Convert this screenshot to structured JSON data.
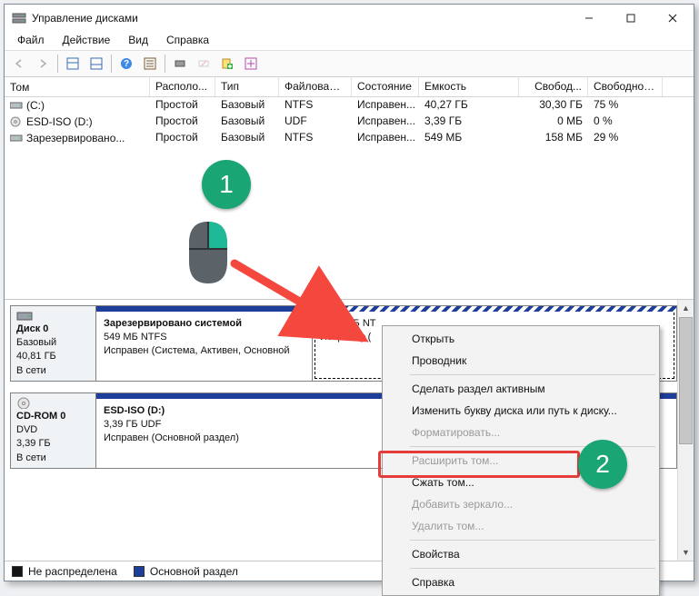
{
  "window": {
    "title": "Управление дисками"
  },
  "menu": {
    "file": "Файл",
    "action": "Действие",
    "view": "Вид",
    "help": "Справка"
  },
  "columns": {
    "volume": "Том",
    "layout": "Располо...",
    "type": "Тип",
    "fs": "Файловая с...",
    "status": "Состояние",
    "capacity": "Емкость",
    "free": "Свобод...",
    "free_pct": "Свободно %"
  },
  "rows": [
    {
      "name": "(C:)",
      "layout": "Простой",
      "type": "Базовый",
      "fs": "NTFS",
      "status": "Исправен...",
      "capacity": "40,27 ГБ",
      "free": "30,30 ГБ",
      "free_pct": "75 %",
      "icon": "drive"
    },
    {
      "name": "ESD-ISO (D:)",
      "layout": "Простой",
      "type": "Базовый",
      "fs": "UDF",
      "status": "Исправен...",
      "capacity": "3,39 ГБ",
      "free": "0 МБ",
      "free_pct": "0 %",
      "icon": "cd"
    },
    {
      "name": "Зарезервировано...",
      "layout": "Простой",
      "type": "Базовый",
      "fs": "NTFS",
      "status": "Исправен...",
      "capacity": "549 МБ",
      "free": "158 МБ",
      "free_pct": "29 %",
      "icon": "drive"
    }
  ],
  "disks": {
    "disk0": {
      "label": "Диск 0",
      "type": "Базовый",
      "size": "40,81 ГБ",
      "state": "В сети",
      "part1": {
        "title": "Зарезервировано системой",
        "sub": "549 МБ NTFS",
        "status": "Исправен (Система, Активен, Основной"
      },
      "part2": {
        "title": "",
        "sub": "40,27 ГБ NT",
        "status": "Исправен ("
      }
    },
    "cdrom": {
      "label": "CD-ROM 0",
      "type": "DVD",
      "size": "3,39 ГБ",
      "state": "В сети",
      "part1": {
        "title": "ESD-ISO  (D:)",
        "sub": "3,39 ГБ UDF",
        "status": "Исправен (Основной раздел)"
      }
    }
  },
  "legend": {
    "unalloc": "Не распределена",
    "primary": "Основной раздел"
  },
  "ctx": {
    "open": "Открыть",
    "explorer": "Проводник",
    "active": "Сделать раздел активным",
    "change_letter": "Изменить букву диска или путь к диску...",
    "format": "Форматировать...",
    "extend": "Расширить том...",
    "shrink": "Сжать том...",
    "mirror": "Добавить зеркало...",
    "delete": "Удалить том...",
    "properties": "Свойства",
    "help": "Справка"
  },
  "badges": {
    "one": "1",
    "two": "2"
  }
}
